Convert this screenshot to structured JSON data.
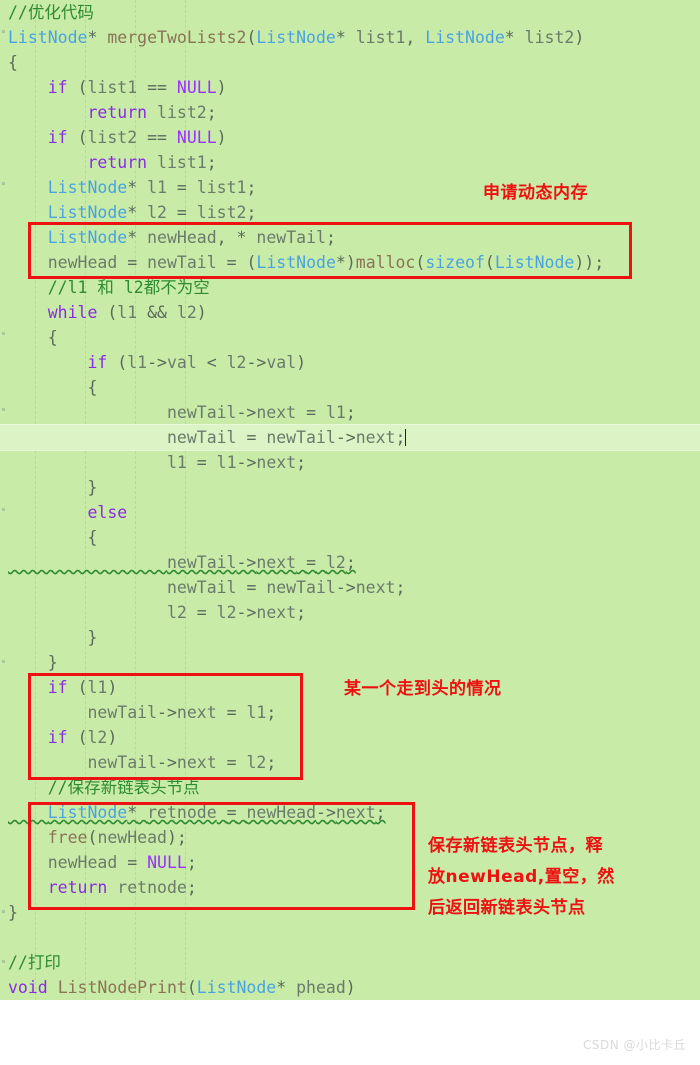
{
  "editor": {
    "background_color": "#c8eba8",
    "current_line_color": "#dcf3c6",
    "annotation_color": "#ee1111",
    "lines": [
      {
        "indent": 0,
        "text": "//优化代码",
        "kind": "comment"
      },
      {
        "indent": 0,
        "text": "ListNode* mergeTwoLists2(ListNode* list1, ListNode* list2)",
        "kind": "code"
      },
      {
        "indent": 0,
        "text": "{",
        "kind": "code"
      },
      {
        "indent": 1,
        "text": "if (list1 == NULL)",
        "kind": "code"
      },
      {
        "indent": 2,
        "text": "return list2;",
        "kind": "code"
      },
      {
        "indent": 1,
        "text": "if (list2 == NULL)",
        "kind": "code"
      },
      {
        "indent": 2,
        "text": "return list1;",
        "kind": "code"
      },
      {
        "indent": 1,
        "text": "ListNode* l1 = list1;",
        "kind": "code"
      },
      {
        "indent": 1,
        "text": "ListNode* l2 = list2;",
        "kind": "code"
      },
      {
        "indent": 1,
        "text": "ListNode* newHead, * newTail;",
        "kind": "code"
      },
      {
        "indent": 1,
        "text": "newHead = newTail = (ListNode*)malloc(sizeof(ListNode));",
        "kind": "code"
      },
      {
        "indent": 1,
        "text": "//l1 和 l2都不为空",
        "kind": "comment"
      },
      {
        "indent": 1,
        "text": "while (l1 && l2)",
        "kind": "code"
      },
      {
        "indent": 1,
        "text": "{",
        "kind": "code"
      },
      {
        "indent": 2,
        "text": "if (l1->val < l2->val)",
        "kind": "code"
      },
      {
        "indent": 2,
        "text": "{",
        "kind": "code"
      },
      {
        "indent": 4,
        "text": "newTail->next = l1;",
        "kind": "code"
      },
      {
        "indent": 4,
        "text": "newTail = newTail->next;",
        "kind": "code",
        "current": true
      },
      {
        "indent": 4,
        "text": "l1 = l1->next;",
        "kind": "code"
      },
      {
        "indent": 2,
        "text": "}",
        "kind": "code"
      },
      {
        "indent": 2,
        "text": "else",
        "kind": "code"
      },
      {
        "indent": 2,
        "text": "{",
        "kind": "code"
      },
      {
        "indent": 4,
        "text": "newTail->next = l2;",
        "kind": "code",
        "squiggly": true
      },
      {
        "indent": 4,
        "text": "newTail = newTail->next;",
        "kind": "code"
      },
      {
        "indent": 4,
        "text": "l2 = l2->next;",
        "kind": "code"
      },
      {
        "indent": 2,
        "text": "}",
        "kind": "code"
      },
      {
        "indent": 1,
        "text": "}",
        "kind": "code"
      },
      {
        "indent": 1,
        "text": "if (l1)",
        "kind": "code"
      },
      {
        "indent": 2,
        "text": "newTail->next = l1;",
        "kind": "code"
      },
      {
        "indent": 1,
        "text": "if (l2)",
        "kind": "code"
      },
      {
        "indent": 2,
        "text": "newTail->next = l2;",
        "kind": "code"
      },
      {
        "indent": 1,
        "text": "//保存新链表头节点",
        "kind": "comment"
      },
      {
        "indent": 1,
        "text": "ListNode* retnode = newHead->next;",
        "kind": "code",
        "squiggly": true
      },
      {
        "indent": 1,
        "text": "free(newHead);",
        "kind": "code"
      },
      {
        "indent": 1,
        "text": "newHead = NULL;",
        "kind": "code"
      },
      {
        "indent": 1,
        "text": "return retnode;",
        "kind": "code"
      },
      {
        "indent": 0,
        "text": "}",
        "kind": "code"
      },
      {
        "indent": 0,
        "text": "",
        "kind": "code"
      },
      {
        "indent": 0,
        "text": "//打印",
        "kind": "comment"
      },
      {
        "indent": 0,
        "text": "void ListNodePrint(ListNode* phead)",
        "kind": "code"
      }
    ]
  },
  "annotations": [
    {
      "id": "anno-malloc",
      "text": "申请动态内存"
    },
    {
      "id": "anno-one-ended",
      "text": "某一个走到头的情况"
    },
    {
      "id": "anno-save-head-1",
      "text": "保存新链表头节点，释"
    },
    {
      "id": "anno-save-head-2",
      "text": "放newHead,置空，然"
    },
    {
      "id": "anno-save-head-3",
      "text": "后返回新链表头节点"
    }
  ],
  "highlight_boxes": [
    {
      "id": "box-malloc",
      "label": "malloc-block"
    },
    {
      "id": "box-tail-fix",
      "label": "tail-fixup-block"
    },
    {
      "id": "box-ret-node",
      "label": "return-node-block"
    }
  ],
  "watermark": {
    "text": "CSDN @小比卡丘"
  }
}
